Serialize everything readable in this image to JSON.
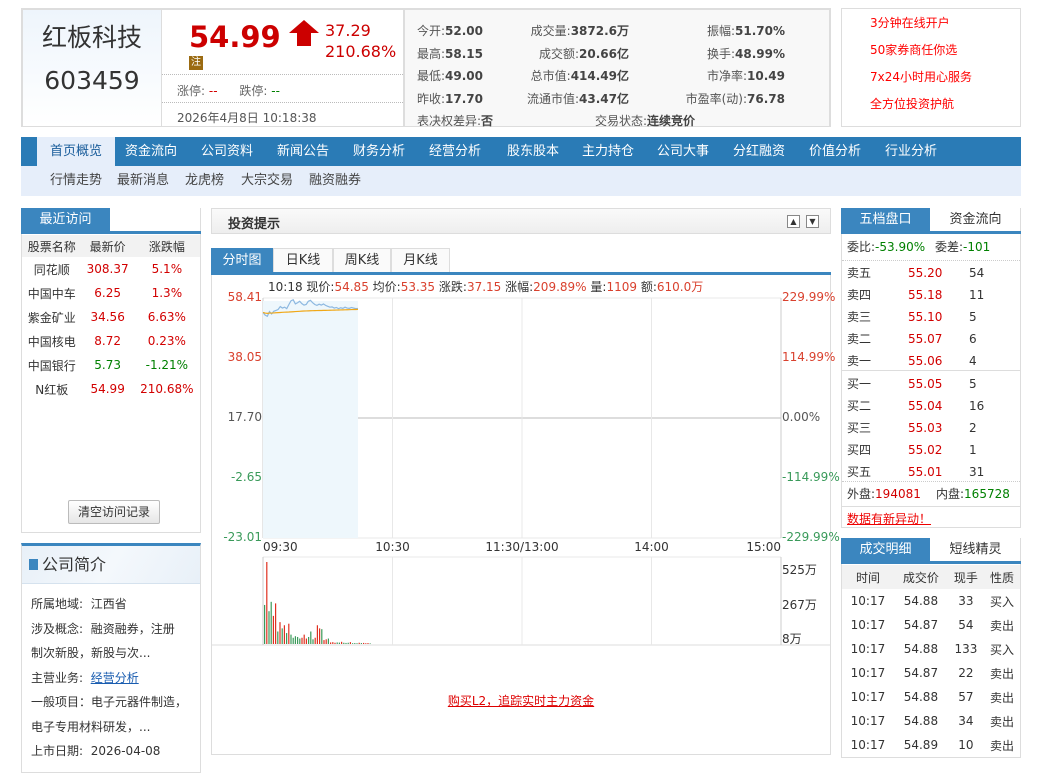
{
  "stock": {
    "name": "红板科技",
    "code": "603459",
    "price": "54.99",
    "badge": "注",
    "change": "37.29",
    "change_pct": "210.68%",
    "limit_up_label": "涨停:",
    "limit_up": "--",
    "limit_down_label": "跌停:",
    "limit_down": "--",
    "timestamp": "2026年4月8日 10:18:38"
  },
  "stats": [
    {
      "label": "今开:",
      "value": "52.00",
      "color": "green"
    },
    {
      "label": "成交量:",
      "value": "3872.6万",
      "color": "red"
    },
    {
      "label": "振幅:",
      "value": "51.70%"
    },
    {
      "label": "最高:",
      "value": "58.15"
    },
    {
      "label": "成交额:",
      "value": "20.66亿"
    },
    {
      "label": "换手:",
      "value": "48.99%"
    },
    {
      "label": "最低:",
      "value": "49.00"
    },
    {
      "label": "总市值:",
      "value": "414.49亿"
    },
    {
      "label": "市净率:",
      "value": "10.49"
    },
    {
      "label": "昨收:",
      "value": "17.70"
    },
    {
      "label": "流通市值:",
      "value": "43.47亿"
    },
    {
      "label": "市盈率(动):",
      "value": "76.78"
    },
    {
      "label": "表决权差异:",
      "value": "否"
    },
    {
      "label": "交易状态:",
      "value": "连续竞价"
    }
  ],
  "ads": [
    "3分钟在线开户",
    "50家券商任你选",
    "7x24小时用心服务",
    "全方位投资护航"
  ],
  "nav": [
    "首页概览",
    "资金流向",
    "公司资料",
    "新闻公告",
    "财务分析",
    "经营分析",
    "股东股本",
    "主力持仓",
    "公司大事",
    "分红融资",
    "价值分析",
    "行业分析"
  ],
  "subnav": [
    "行情走势",
    "最新消息",
    "龙虎榜",
    "大宗交易",
    "融资融券"
  ],
  "recent": {
    "title": "最近访问",
    "headers": [
      "股票名称",
      "最新价",
      "涨跌幅"
    ],
    "rows": [
      [
        "同花顺",
        "308.37",
        "5.1%",
        "up"
      ],
      [
        "中国中车",
        "6.25",
        "1.3%",
        "up"
      ],
      [
        "紫金矿业",
        "34.56",
        "6.63%",
        "up"
      ],
      [
        "中国核电",
        "8.72",
        "0.23%",
        "up"
      ],
      [
        "中国银行",
        "5.73",
        "-1.21%",
        "down"
      ],
      [
        "N红板",
        "54.99",
        "210.68%",
        "up"
      ]
    ],
    "clear_button": "清空访问记录"
  },
  "profile": {
    "title": "公司简介",
    "region_label": "所属地域:",
    "region": "江西省",
    "concept_label": "涉及概念:",
    "concept1": "融资融券，注册",
    "concept2": "制次新股，新股与次...",
    "business_label": "主营业务:",
    "business_link": "经营分析",
    "scope1": "一般项目：电子元器件制造，",
    "scope2": "电子专用材料研发，...",
    "ipo_label": "上市日期:",
    "ipo_date": "2026-04-08"
  },
  "tips": {
    "title": "投资提示"
  },
  "chart_tabs": [
    "分时图",
    "日K线",
    "周K线",
    "月K线"
  ],
  "chart_info": {
    "time": "10:18",
    "now_label": "现价:",
    "now": "54.85",
    "avg_label": "均价:",
    "avg": "53.35",
    "chg_label": "涨跌:",
    "chg": "37.15",
    "pct_label": "涨幅:",
    "pct": "209.89%",
    "vol_label": "量:",
    "vol": "1109",
    "amt_label": "额:",
    "amt": "610.0万"
  },
  "chart_data": {
    "type": "line",
    "y_left": [
      "58.41",
      "38.05",
      "17.70",
      "-2.65",
      "-23.01"
    ],
    "y_right": [
      "229.99%",
      "114.99%",
      "0.00%",
      "-114.99%",
      "-229.99%"
    ],
    "x_labels": [
      "09:30",
      "10:30",
      "11:30/13:00",
      "14:00",
      "15:00"
    ],
    "vol_labels": [
      "525万",
      "267万",
      "8万"
    ],
    "ylim": [
      -23.01,
      58.41
    ],
    "minutes_total": 240,
    "price": [
      53.5,
      52.6,
      52.2,
      53.8,
      53.0,
      53.9,
      54.2,
      54.5,
      55.5,
      55.0,
      55.3,
      54.8,
      56.2,
      57.5,
      57.8,
      56.4,
      56.8,
      57.3,
      56.5,
      56.0,
      56.2,
      57.3,
      57.6,
      56.8,
      56.2,
      55.9,
      56.3,
      56.0,
      56.4,
      55.9,
      55.6,
      55.3,
      55.4,
      55.0,
      55.2,
      54.8,
      55.1,
      54.9,
      55.3,
      55.0,
      54.9,
      55.2,
      55.0,
      54.8,
      54.85
    ],
    "avg": [
      53.5,
      53.3,
      53.2,
      53.3,
      53.3,
      53.35,
      53.4,
      53.45,
      53.5,
      53.55,
      53.6,
      53.62,
      53.65,
      53.7,
      53.75,
      53.8,
      53.85,
      53.9,
      53.95,
      54.0,
      54.02,
      54.05,
      54.08,
      54.1,
      54.12,
      54.14,
      54.16,
      54.18,
      54.2,
      54.22,
      54.24,
      54.26,
      54.28,
      54.3,
      54.32,
      54.34,
      54.36,
      54.38,
      54.4,
      54.42,
      54.45,
      54.48,
      54.5,
      54.52,
      54.55
    ],
    "volume": [
      250,
      525,
      210,
      270,
      180,
      260,
      80,
      140,
      100,
      120,
      70,
      130,
      60,
      40,
      50,
      45,
      35,
      40,
      60,
      35,
      45,
      80,
      30,
      40,
      120,
      100,
      95,
      25,
      30,
      35,
      10,
      12,
      8,
      10,
      9,
      14,
      8,
      7,
      8,
      12,
      5,
      6,
      5,
      8,
      6,
      7,
      5,
      6,
      4
    ],
    "vol_up": [
      0,
      1,
      0,
      0,
      1,
      1,
      0,
      1,
      0,
      1,
      0,
      1,
      0,
      0,
      0,
      0,
      0,
      1,
      1,
      1,
      0,
      0,
      0,
      1,
      1,
      1,
      0,
      1,
      1,
      0,
      1,
      1,
      1,
      0,
      0,
      1,
      0,
      0,
      0,
      1,
      0,
      0,
      0,
      1,
      0,
      1,
      1,
      1,
      0
    ],
    "vol_max": 525
  },
  "chart_footer_link": "购买L2，追踪实时主力资金",
  "orderbook": {
    "tab_active": "五档盘口",
    "tab_other": "资金流向",
    "wb_label": "委比:",
    "wb": "-53.90%",
    "wc_label": "委差:",
    "wc": "-101",
    "sell": [
      [
        "卖五",
        "55.20",
        "54"
      ],
      [
        "卖四",
        "55.18",
        "11"
      ],
      [
        "卖三",
        "55.10",
        "5"
      ],
      [
        "卖二",
        "55.07",
        "6"
      ],
      [
        "卖一",
        "55.06",
        "4"
      ]
    ],
    "buy": [
      [
        "买一",
        "55.05",
        "5"
      ],
      [
        "买二",
        "55.04",
        "16"
      ],
      [
        "买三",
        "55.03",
        "2"
      ],
      [
        "买四",
        "55.02",
        "1"
      ],
      [
        "买五",
        "55.01",
        "31"
      ]
    ],
    "outer_label": "外盘:",
    "outer": "194081",
    "inner_label": "内盘:",
    "inner": "165728",
    "alert": "数据有新异动！"
  },
  "trades": {
    "tab_active": "成交明细",
    "tab_other": "短线精灵",
    "headers": [
      "时间",
      "成交价",
      "现手",
      "性质"
    ],
    "rows": [
      [
        "10:17",
        "54.88",
        "33",
        "买入"
      ],
      [
        "10:17",
        "54.87",
        "54",
        "卖出"
      ],
      [
        "10:17",
        "54.88",
        "133",
        "买入"
      ],
      [
        "10:17",
        "54.87",
        "22",
        "卖出"
      ],
      [
        "10:17",
        "54.88",
        "57",
        "卖出"
      ],
      [
        "10:17",
        "54.88",
        "34",
        "卖出"
      ],
      [
        "10:17",
        "54.89",
        "10",
        "卖出"
      ]
    ]
  }
}
